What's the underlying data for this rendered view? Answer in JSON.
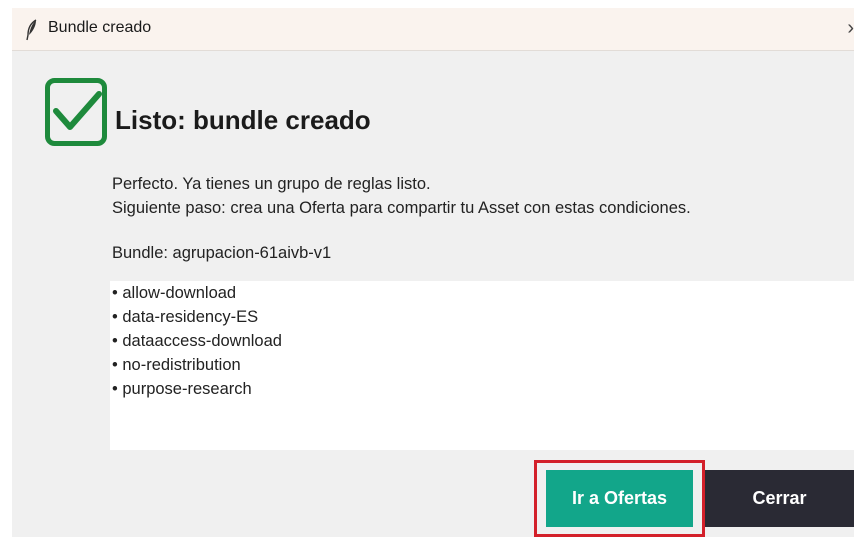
{
  "window": {
    "title": "Bundle creado",
    "close_glyph": "›"
  },
  "dialog": {
    "heading": "Listo: bundle creado",
    "message_line1": "Perfecto. Ya tienes un grupo de reglas listo.",
    "message_line2": "Siguiente paso: crea una Oferta para compartir tu Asset con estas condiciones.",
    "bundle_line": "Bundle: agrupacion-61aivb-v1",
    "rules": [
      "• allow-download",
      "• data-residency-ES",
      "• dataaccess-download",
      "• no-redistribution",
      "• purpose-research"
    ]
  },
  "buttons": {
    "primary": "Ir a Ofertas",
    "secondary": "Cerrar"
  },
  "icons": {
    "app": "feather-icon",
    "status": "checkmark-icon",
    "close": "chevron-right-icon"
  },
  "colors": {
    "primary": "#12a68a",
    "secondary": "#2a2a34",
    "check": "#1e8a3c",
    "highlight": "#d3202a"
  }
}
